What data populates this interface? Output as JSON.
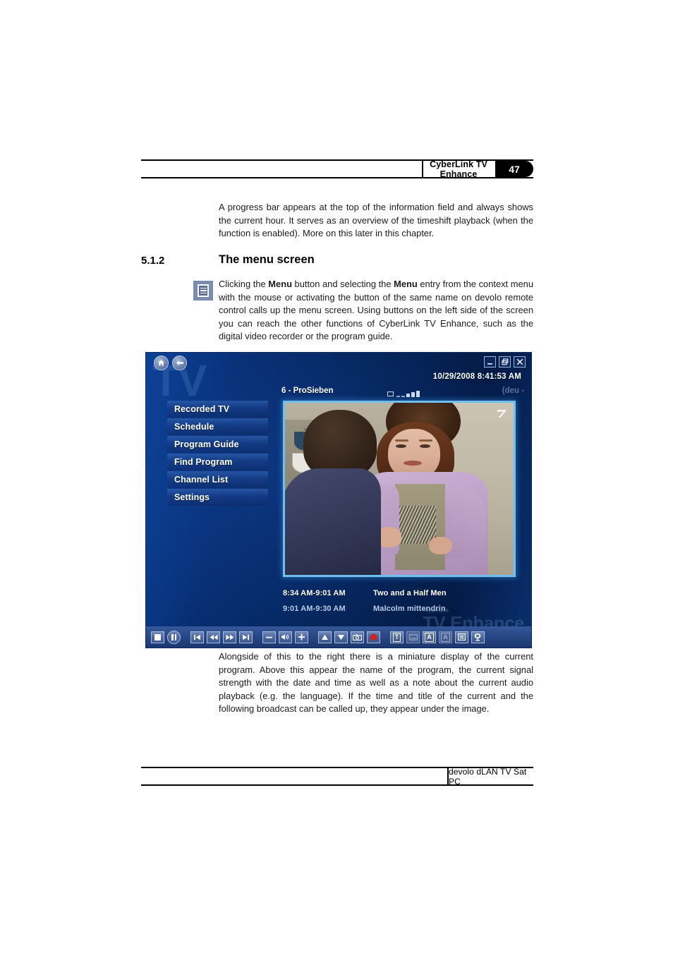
{
  "header": {
    "title": "CyberLink TV Enhance",
    "page_number": "47"
  },
  "footer": {
    "text": "devolo dLAN TV Sat PC"
  },
  "content": {
    "intro_paragraph": "A progress bar appears at the top of the information field and always shows the current hour. It serves as an overview of the timeshift playback (when the function is enabled). More on this later in this chapter.",
    "section_number": "5.1.2",
    "section_title": "The menu screen",
    "description_before": "Clicking the ",
    "description_bold_1": "Menu",
    "description_mid": " button and selecting the ",
    "description_bold_2": "Menu",
    "description_after": " entry from the context menu with the mouse or activating the button of the same name on devolo remote control calls up the menu screen. Using buttons on the left side of the screen you can reach the other functions of CyberLink TV Enhance, such as the digital video recorder or the program guide.",
    "bottom_paragraph": "Alongside of this to the right there is a miniature display of the current program. Above this appear the name of the program, the current signal strength with the date and time as well as a note about the current audio playback (e.g. the language). If the time and title of the current and the following broadcast can be called up, they appear under the image."
  },
  "tv_app": {
    "watermark": "TV",
    "datetime": "10/29/2008 8:41:53 AM",
    "channel": "6 - ProSieben",
    "audio_language": "(deu -",
    "nav": [
      {
        "name": "home-icon",
        "label": "Home"
      },
      {
        "name": "back-icon",
        "label": "Back"
      }
    ],
    "window_controls": [
      {
        "name": "minimize-button",
        "label": "_"
      },
      {
        "name": "restore-button",
        "label": "❐"
      },
      {
        "name": "close-button",
        "label": "×"
      }
    ],
    "menu_items": [
      "Recorded TV",
      "Schedule",
      "Program Guide",
      "Find Program",
      "Channel List",
      "Settings"
    ],
    "programs": [
      {
        "time": "8:34 AM-9:01 AM",
        "title": "Two and a Half Men"
      },
      {
        "time": "9:01 AM-9:30 AM",
        "title": "Malcolm mittendrin"
      }
    ],
    "cyberlink_watermark_small": "CyberLink",
    "cyberlink_watermark_big": "TV Enhance",
    "controls": [
      {
        "name": "stop-button"
      },
      {
        "name": "pause-button"
      },
      {
        "name": "previous-button"
      },
      {
        "name": "rewind-button"
      },
      {
        "name": "fast-forward-button"
      },
      {
        "name": "next-button"
      },
      {
        "name": "volume-down-button"
      },
      {
        "name": "mute-button"
      },
      {
        "name": "volume-up-button"
      },
      {
        "name": "channel-up-button"
      },
      {
        "name": "channel-down-button"
      },
      {
        "name": "snapshot-button"
      },
      {
        "name": "record-button"
      },
      {
        "name": "teletext-button",
        "label": "T"
      },
      {
        "name": "subtitle-button"
      },
      {
        "name": "audio-button",
        "label": "A"
      },
      {
        "name": "audio-alt-button",
        "label": "A"
      },
      {
        "name": "menu-button"
      },
      {
        "name": "satellite-button"
      }
    ],
    "colors": {
      "background_light": "#0b4096",
      "background_dark": "#031a44",
      "menu_text": "#ffffff",
      "video_border": "#6fc0f0",
      "record_red": "#e01a1a"
    }
  }
}
